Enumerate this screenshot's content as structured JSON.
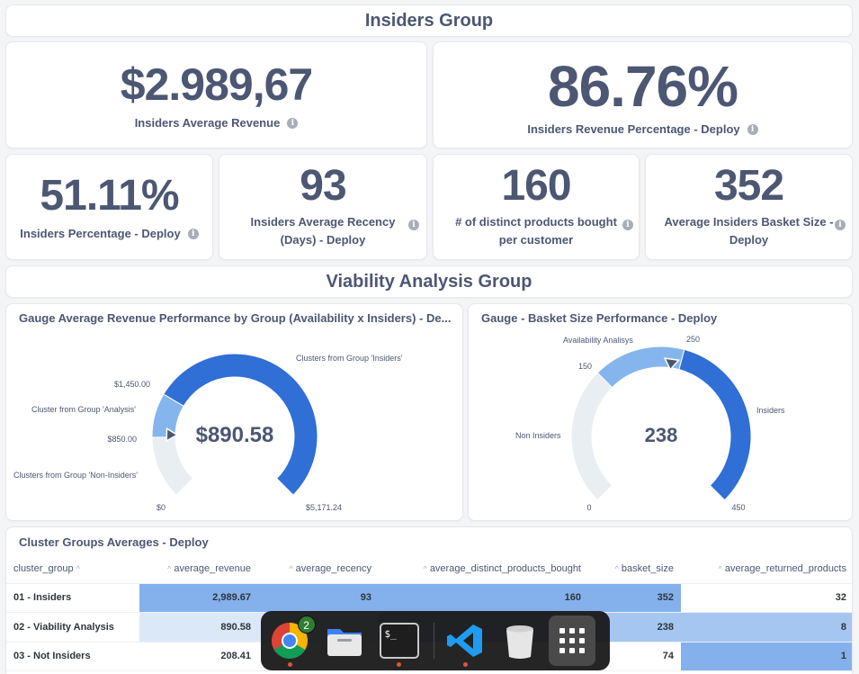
{
  "insiders_header": "Insiders Group",
  "scalars": {
    "avg_revenue": {
      "value": "$2.989,67",
      "label": "Insiders Average Revenue"
    },
    "revenue_pct": {
      "value": "86.76%",
      "label": "Insiders Revenue Percentage - Deploy"
    },
    "insiders_pct": {
      "value": "51.11%",
      "label": "Insiders Percentage - Deploy"
    },
    "avg_recency": {
      "value": "93",
      "label_line1": "Insiders Average Recency",
      "label_line2": "(Days) - Deploy"
    },
    "distinct_products": {
      "value": "160",
      "label_line1": "# of distinct products bought",
      "label_line2": "per customer"
    },
    "basket_size": {
      "value": "352",
      "label_line1": "Average Insiders Basket Size -",
      "label_line2": "Deploy"
    }
  },
  "viability_header": "Viability Analysis Group",
  "gauge1": {
    "title": "Gauge Average Revenue Performance by Group (Availability x Insiders) - De...",
    "value_text": "$890.58",
    "min_label": "$0",
    "max_label": "$5,171.24",
    "tick_850": "$850.00",
    "tick_1450": "$1,450.00",
    "seg_non_insiders": "Clusters from Group 'Non-Insiders'",
    "seg_analysis": "Cluster from Group 'Analysis'",
    "seg_insiders": "Clusters from Group 'Insiders'",
    "min": 0,
    "max": 5171.24,
    "value": 890.58,
    "segments": [
      {
        "to": 850,
        "color": "#e9eef3"
      },
      {
        "to": 1450,
        "color": "#84b5ed"
      },
      {
        "to": 5171.24,
        "color": "#2f6fd6"
      }
    ]
  },
  "gauge2": {
    "title": "Gauge - Basket Size Performance - Deploy",
    "value_text": "238",
    "min_label": "0",
    "max_label": "450",
    "tick_150": "150",
    "tick_250": "250",
    "seg_non_insiders": "Non Insiders",
    "seg_availability": "Availability Analisys",
    "seg_insiders": "Insiders",
    "min": 0,
    "max": 450,
    "value": 238,
    "segments": [
      {
        "to": 150,
        "color": "#e9eef3"
      },
      {
        "to": 250,
        "color": "#84b5ed"
      },
      {
        "to": 450,
        "color": "#2f6fd6"
      }
    ]
  },
  "table": {
    "title": "Cluster Groups Averages - Deploy",
    "headers": [
      "cluster_group",
      "average_revenue",
      "average_recency",
      "average_distinct_products_bought",
      "basket_size",
      "average_returned_products"
    ],
    "rows": [
      [
        "01 - Insiders",
        "2,989.67",
        "93",
        "160",
        "352",
        "32"
      ],
      [
        "02 - Viability Analysis",
        "890.58",
        "",
        "",
        "238",
        "8"
      ],
      [
        "03 - Not Insiders",
        "208.41",
        "",
        "",
        "74",
        "1"
      ]
    ]
  },
  "dock": {
    "items": [
      "chrome-icon",
      "files-icon",
      "terminal-icon",
      "vscode-icon",
      "trash-icon",
      "apps-grid-icon"
    ],
    "chrome_badge": "2",
    "terminal_glyph": "$_"
  },
  "colors": {
    "text": "#4c5773",
    "strong_blue": "#84b1ec",
    "mid_blue": "#a5c6f1",
    "light_blue": "#dbe8f8",
    "gauge_dark": "#2f6fd6",
    "gauge_mid": "#84b5ed",
    "gauge_light": "#e9eef3"
  }
}
